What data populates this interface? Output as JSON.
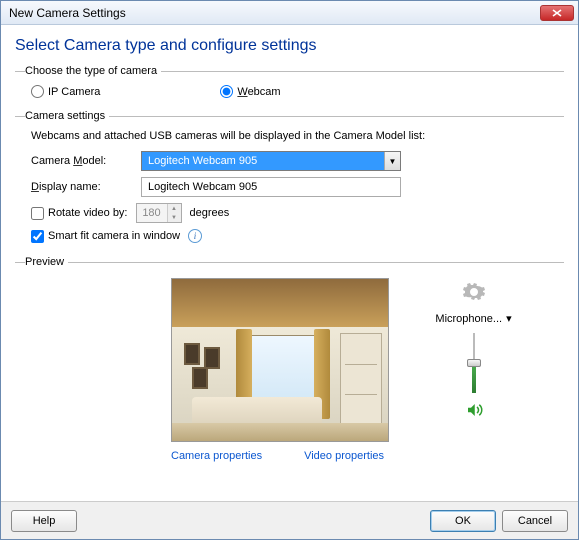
{
  "window": {
    "title": "New Camera Settings"
  },
  "header": {
    "title": "Select Camera type and configure settings"
  },
  "typeGroup": {
    "legend": "Choose the type of camera",
    "ip": {
      "label": "IP Camera",
      "mnemonic": "I"
    },
    "webcam": {
      "label": "ebcam",
      "mnemonic": "W"
    },
    "selected": "webcam"
  },
  "settingsGroup": {
    "legend": "Camera settings",
    "info": "Webcams and attached USB cameras will be displayed in the Camera Model list:",
    "model": {
      "label": "Camera ",
      "mnemonicTail": "odel:",
      "mnemonic": "M",
      "value": "Logitech Webcam 905"
    },
    "displayName": {
      "label": "isplay name:",
      "mnemonic": "D",
      "value": "Logitech Webcam 905"
    },
    "rotate": {
      "label": "Rotate video by:",
      "value": "180",
      "unit": "degrees",
      "checked": false
    },
    "smartFit": {
      "label": "Smart fit camera in window",
      "checked": true
    }
  },
  "previewGroup": {
    "legend": "Preview",
    "cameraProps": "Camera properties",
    "videoProps": "Video properties",
    "micLabel": "Microphone..."
  },
  "footer": {
    "help": "Help",
    "ok": "OK",
    "cancel": "Cancel"
  }
}
